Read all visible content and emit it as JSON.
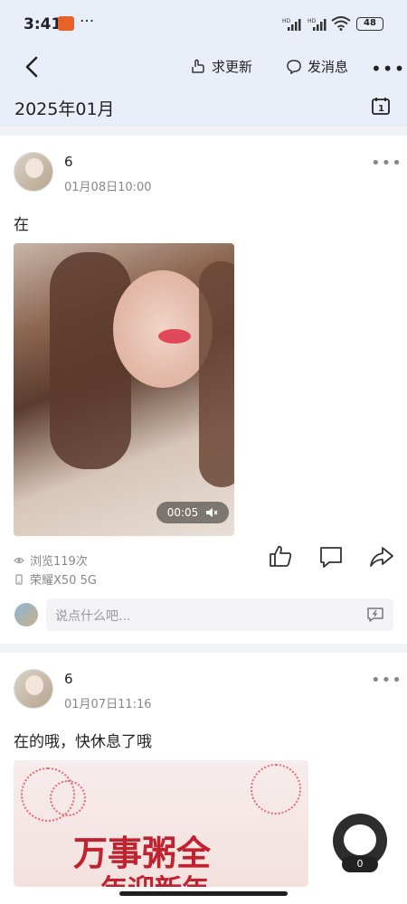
{
  "status_bar": {
    "time": "3:41",
    "dots": "···",
    "battery": "48",
    "signal_1": "HD",
    "signal_2": "HD"
  },
  "nav": {
    "back_icon": "chevron-left-icon",
    "request_update_label": "求更新",
    "send_message_label": "发消息",
    "more_icon": "more-horizontal-icon"
  },
  "month_header": {
    "label": "2025年01月",
    "calendar_day": "1"
  },
  "posts": [
    {
      "username": "6",
      "timestamp": "01月08日10:00",
      "text": "在",
      "media_type": "video",
      "video_duration": "00:05",
      "views": "浏览119次",
      "device": "荣耀X50 5G",
      "comment_placeholder": "说点什么吧..."
    },
    {
      "username": "6",
      "timestamp": "01月07日11:16",
      "text": "在的哦，快休息了哦",
      "media_type": "image",
      "image_text_line1": "万事粥全",
      "image_text_line2": "年迎新年"
    }
  ],
  "floating_button": {
    "count": "0"
  },
  "colors": {
    "header_bg": "#e9eef8",
    "page_bg": "#f2f3f5",
    "card_bg": "#ffffff",
    "muted_text": "#888888"
  }
}
